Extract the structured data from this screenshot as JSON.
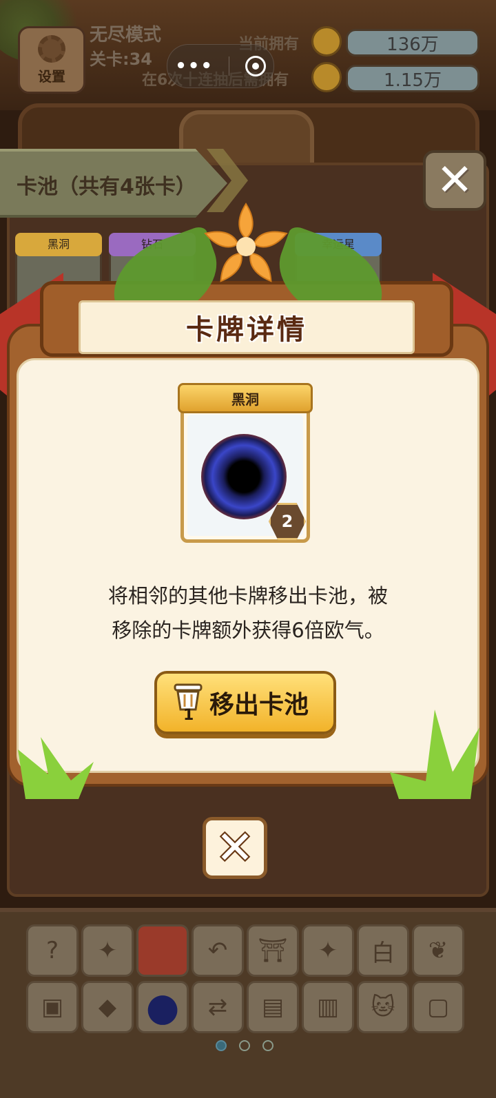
{
  "hud": {
    "settings_label": "设置",
    "mode_label": "无尽模式",
    "stage_label": "关卡:34",
    "owned_label": "当前拥有",
    "owned_value": "136万",
    "required_label": "在6次十连抽后需拥有",
    "required_value": "1.15万"
  },
  "pool": {
    "title": "卡池（共有4张卡）",
    "cards": [
      "黑洞",
      "钻石",
      "",
      "幸运星"
    ]
  },
  "modal": {
    "title": "卡牌详情",
    "card_name": "黑洞",
    "card_level": "2",
    "description_line1": "将相邻的其他卡牌移出卡池，被",
    "description_line2": "移除的卡牌额外获得6倍欧气。",
    "remove_button_label": "移出卡池",
    "remove_count": "1"
  },
  "tray": {
    "row1_icons": [
      "cards-question-icon",
      "magic-wand-icon",
      "trash-icon",
      "undo-icon",
      "temple-icon",
      "magic-wand-icon",
      "white-tile-icon",
      "feather-icon"
    ],
    "row2_icons": [
      "card-swap-icon",
      "diamond-icon",
      "black-hole-icon",
      "shuffle-icon",
      "treasure-box-icon",
      "cards-fan-icon",
      "cat-icon",
      "card-coins-icon"
    ],
    "row1_glyphs": [
      "?",
      "✦",
      "",
      "↶",
      "⛩",
      "✦",
      "白",
      "❦"
    ],
    "row2_glyphs": [
      "▣",
      "◆",
      "●",
      "⇄",
      "▤",
      "▥",
      "🐱",
      "▢"
    ],
    "page_count": 3,
    "active_page": 1
  },
  "colors": {
    "accent_gold": "#f2b32a",
    "ribbon_red": "#b83428",
    "wood": "#a2622e"
  }
}
